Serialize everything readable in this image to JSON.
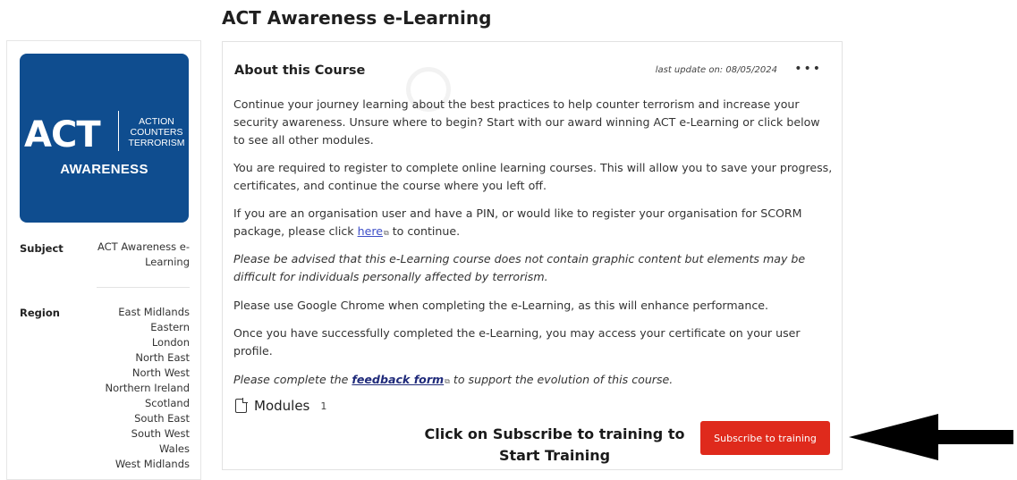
{
  "page": {
    "title": "ACT Awareness e-Learning"
  },
  "logo": {
    "act": "ACT",
    "sub": [
      "ACTION",
      "COUNTERS",
      "TERRORISM"
    ],
    "awareness": "AWARENESS",
    "bg_color": "#0f4d8f"
  },
  "sidebar": {
    "subject_label": "Subject",
    "subject_value_line1": "ACT Awareness e-",
    "subject_value_line2": "Learning",
    "region_label": "Region",
    "regions": [
      "East Midlands",
      "Eastern",
      "London",
      "North East",
      "North West",
      "Northern Ireland",
      "Scotland",
      "South East",
      "South West",
      "Wales",
      "West Midlands"
    ]
  },
  "card": {
    "heading": "About this Course",
    "last_update": "last update on: 08/05/2024",
    "more_icon": "more-horizontal-icon",
    "p1": "Continue your journey learning about the best practices to help counter terrorism and increase your security awareness. Unsure where to begin? Start with our award winning ACT e-Learning or click below to see all other modules.",
    "p2": "You are required to register to complete online learning courses. This will allow you to save your progress, certificates, and continue the course where you left off.",
    "p3_before": "If you are an organisation user and have a PIN, or would like to register your organisation for SCORM package, please click ",
    "p3_link": "here",
    "p3_after": " to continue.",
    "p4": "Please be advised that this e-Learning course does not contain graphic content but elements may be difficult for individuals personally affected by terrorism.",
    "p5": "Please use Google Chrome when completing the e-Learning, as this will enhance performance.",
    "p6": "Once you have successfully completed the e-Learning, you may access your certificate on your user profile.",
    "p7_before": "Please complete the ",
    "p7_link": "feedback form",
    "p7_after": " to support the evolution of this course.",
    "modules_label": "Modules",
    "modules_count": "1"
  },
  "cta": {
    "subscribe_label": "Subscribe to training",
    "callout_line1": "Click on Subscribe to training to",
    "callout_line2": "Start Training",
    "accent_color": "#df2a1c"
  }
}
